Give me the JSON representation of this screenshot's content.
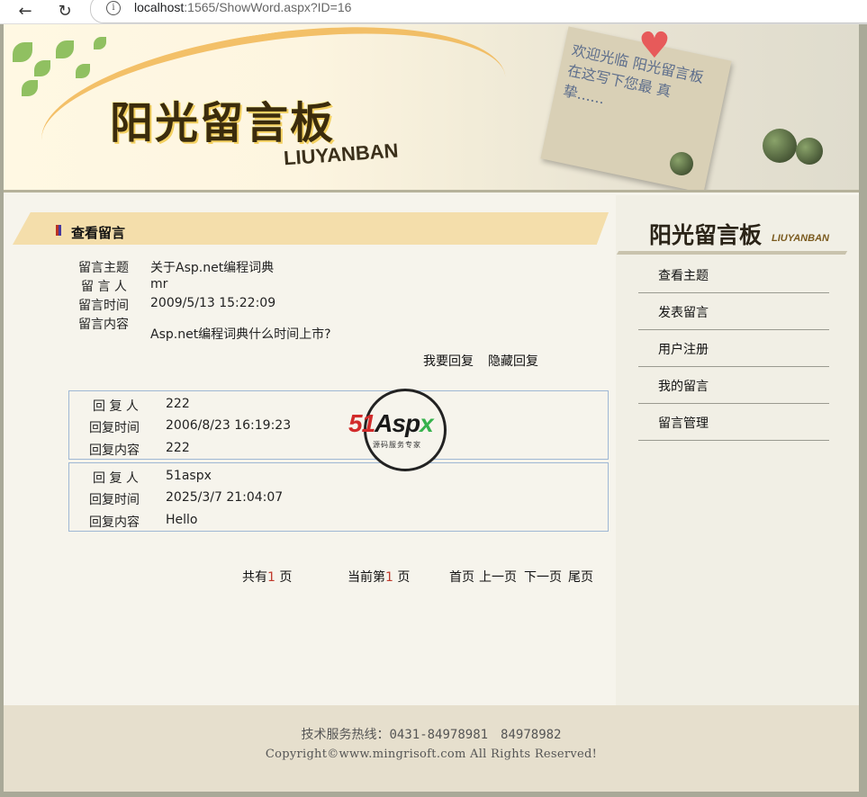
{
  "browser": {
    "url_host": "localhost",
    "url_rest": ":1565/ShowWord.aspx?ID=16",
    "back_icon": "←",
    "reload_icon": "↻"
  },
  "banner": {
    "title": "阳光留言板",
    "subtitle": "LIUYANBAN",
    "note_text": "欢迎光临 阳光留言板 在这写下您最 真挚......"
  },
  "section": {
    "title": "查看留言"
  },
  "message": {
    "subject_label": "留言主题",
    "subject": "关于Asp.net编程词典",
    "author_label": "留 言 人",
    "author": "mr",
    "time_label": "留言时间",
    "time": "2009/5/13 15:22:09",
    "content_label": "留言内容",
    "content": "Asp.net编程词典什么时间上市?"
  },
  "actions": {
    "reply": "我要回复",
    "hide_reply": "隐藏回复"
  },
  "replies": [
    {
      "author_label": "回 复 人",
      "author": "222",
      "time_label": "回复时间",
      "time": "2006/8/23 16:19:23",
      "content_label": "回复内容",
      "content": "222"
    },
    {
      "author_label": "回 复 人",
      "author": "51aspx",
      "time_label": "回复时间",
      "time": "2025/3/7 21:04:07",
      "content_label": "回复内容",
      "content": "Hello"
    }
  ],
  "pager": {
    "total_prefix": "共有",
    "total": "1",
    "total_suffix": " 页",
    "current_prefix": "当前第",
    "current": "1",
    "current_suffix": " 页",
    "first": "首页",
    "prev": "上一页",
    "next": "下一页",
    "last": "尾页"
  },
  "watermark": {
    "brand_a": "51",
    "brand_b": "Asp",
    "brand_c": "x",
    "tagline": "源码服务专家"
  },
  "sidebar": {
    "title": "阳光留言板",
    "title_sub": "LIUYANBAN",
    "items": [
      {
        "label": "查看主题"
      },
      {
        "label": "发表留言"
      },
      {
        "label": "用户注册"
      },
      {
        "label": "我的留言"
      },
      {
        "label": "留言管理"
      }
    ]
  },
  "footer": {
    "hotline": "技术服务热线：0431-84978981　84978982",
    "copyright": "Copyright©www.mingrisoft.com All Rights Reserved!"
  }
}
